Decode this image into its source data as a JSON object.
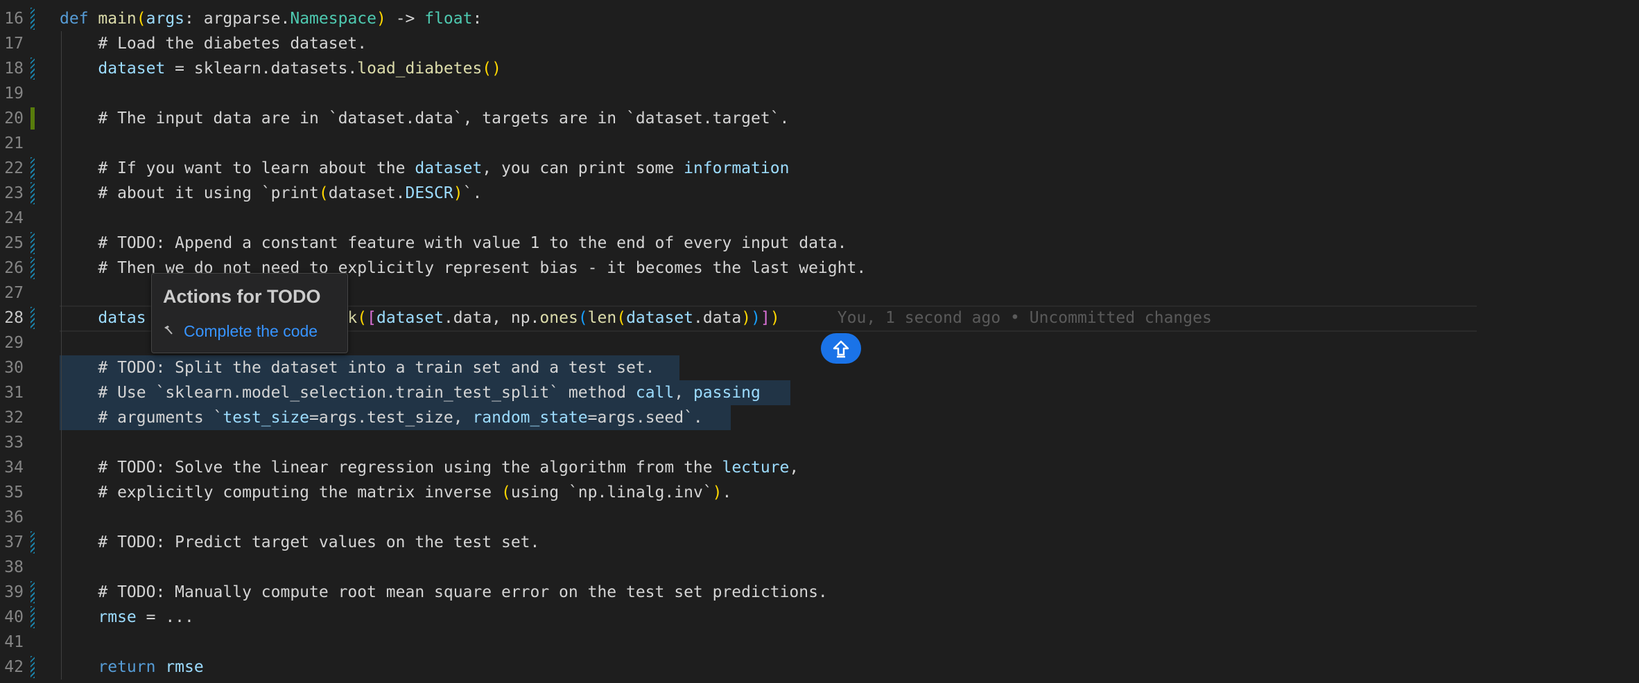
{
  "editor": {
    "lines": [
      {
        "n": "16",
        "mark": "mod",
        "tokens": [
          [
            "kw",
            "def "
          ],
          [
            "fn",
            "main"
          ],
          [
            "br1",
            "("
          ],
          [
            "var",
            "args"
          ],
          [
            "plain",
            ": argparse."
          ],
          [
            "ty",
            "Namespace"
          ],
          [
            "br1",
            ")"
          ],
          [
            "plain",
            " -> "
          ],
          [
            "ty",
            "float"
          ],
          [
            "plain",
            ":"
          ]
        ]
      },
      {
        "n": "17",
        "mark": "none",
        "tokens": [
          [
            "plain",
            "    # Load the diabetes dataset."
          ]
        ]
      },
      {
        "n": "18",
        "mark": "mod",
        "tokens": [
          [
            "var",
            "    dataset"
          ],
          [
            "plain",
            " = sklearn.datasets."
          ],
          [
            "fn",
            "load_diabetes"
          ],
          [
            "br1",
            "()"
          ]
        ]
      },
      {
        "n": "19",
        "mark": "none",
        "tokens": []
      },
      {
        "n": "20",
        "mark": "add",
        "tokens": [
          [
            "plain",
            "    # The input data are in `dataset.data`, targets are in `dataset.target`."
          ]
        ]
      },
      {
        "n": "21",
        "mark": "none",
        "tokens": []
      },
      {
        "n": "22",
        "mark": "mod",
        "tokens": [
          [
            "plain",
            "    # If you want to learn about the "
          ],
          [
            "var",
            "dataset"
          ],
          [
            "plain",
            ", you can print some "
          ],
          [
            "var",
            "information"
          ]
        ]
      },
      {
        "n": "23",
        "mark": "mod",
        "tokens": [
          [
            "plain",
            "    # about it using `print"
          ],
          [
            "br1",
            "("
          ],
          [
            "plain",
            "dataset."
          ],
          [
            "var",
            "DESCR"
          ],
          [
            "br1",
            ")"
          ],
          [
            "plain",
            "`."
          ]
        ]
      },
      {
        "n": "24",
        "mark": "none",
        "tokens": []
      },
      {
        "n": "25",
        "mark": "mod",
        "tokens": [
          [
            "plain",
            "    # TODO: Append a constant feature with value 1 to the end of every input data."
          ]
        ]
      },
      {
        "n": "26",
        "mark": "mod",
        "tokens": [
          [
            "plain",
            "    # Then we do not need to explicitly represent bias - it becomes the last weight."
          ]
        ]
      },
      {
        "n": "27",
        "mark": "none",
        "tokens": []
      },
      {
        "n": "28",
        "mark": "mod",
        "active": true,
        "tokens": [
          [
            "var",
            "    datas"
          ],
          [
            "plain",
            "                 "
          ],
          [
            "fn",
            "stack"
          ],
          [
            "br1",
            "("
          ],
          [
            "br2",
            "["
          ],
          [
            "var",
            "dataset"
          ],
          [
            "plain",
            ".data, np."
          ],
          [
            "fn",
            "ones"
          ],
          [
            "br3",
            "("
          ],
          [
            "fn",
            "len"
          ],
          [
            "br1",
            "("
          ],
          [
            "var",
            "dataset"
          ],
          [
            "plain",
            ".data"
          ],
          [
            "br1",
            ")"
          ],
          [
            "br3",
            ")"
          ],
          [
            "br2",
            "]"
          ],
          [
            "br1",
            ")"
          ],
          [
            "blame",
            "      You, 1 second ago • Uncommitted changes"
          ]
        ]
      },
      {
        "n": "29",
        "mark": "none",
        "tokens": []
      },
      {
        "n": "30",
        "mark": "none",
        "sel": [
          86,
          980
        ],
        "tokens": [
          [
            "plain",
            "    # TODO: Split the dataset into a train set and a test set."
          ]
        ]
      },
      {
        "n": "31",
        "mark": "none",
        "sel": [
          86,
          1140
        ],
        "tokens": [
          [
            "plain",
            "    # Use `sklearn.model_selection.train_test_split` method "
          ],
          [
            "var",
            "call"
          ],
          [
            "plain",
            ", "
          ],
          [
            "var",
            "passing"
          ]
        ]
      },
      {
        "n": "32",
        "mark": "none",
        "sel": [
          86,
          1054
        ],
        "tokens": [
          [
            "plain",
            "    # arguments `"
          ],
          [
            "var",
            "test_size"
          ],
          [
            "plain",
            "=args.test_size, "
          ],
          [
            "var",
            "random_state"
          ],
          [
            "plain",
            "=args.seed`."
          ]
        ]
      },
      {
        "n": "33",
        "mark": "none",
        "tokens": []
      },
      {
        "n": "34",
        "mark": "none",
        "tokens": [
          [
            "plain",
            "    # TODO: Solve the linear regression using the algorithm from the "
          ],
          [
            "var",
            "lecture"
          ],
          [
            "plain",
            ","
          ]
        ]
      },
      {
        "n": "35",
        "mark": "none",
        "tokens": [
          [
            "plain",
            "    # explicitly computing the matrix inverse "
          ],
          [
            "br1",
            "("
          ],
          [
            "plain",
            "using `np.linalg.inv`"
          ],
          [
            "br1",
            ")"
          ],
          [
            "plain",
            "."
          ]
        ]
      },
      {
        "n": "36",
        "mark": "none",
        "tokens": []
      },
      {
        "n": "37",
        "mark": "mod",
        "tokens": [
          [
            "plain",
            "    # TODO: Predict target values on the test set."
          ]
        ]
      },
      {
        "n": "38",
        "mark": "none",
        "tokens": []
      },
      {
        "n": "39",
        "mark": "mod",
        "tokens": [
          [
            "plain",
            "    # TODO: Manually compute root mean square error on the test set predictions."
          ]
        ]
      },
      {
        "n": "40",
        "mark": "mod",
        "tokens": [
          [
            "var",
            "    rmse"
          ],
          [
            "plain",
            " = ..."
          ]
        ]
      },
      {
        "n": "41",
        "mark": "none",
        "tokens": []
      },
      {
        "n": "42",
        "mark": "mod",
        "tokens": [
          [
            "kw",
            "    return "
          ],
          [
            "var",
            "rmse"
          ]
        ]
      }
    ]
  },
  "popup": {
    "title": "Actions for TODO",
    "action_label": "Complete the code",
    "action_icon": "hammer-icon"
  },
  "copilot_button": {
    "icon": "arrow-up-icon",
    "color": "#1a73e8"
  }
}
